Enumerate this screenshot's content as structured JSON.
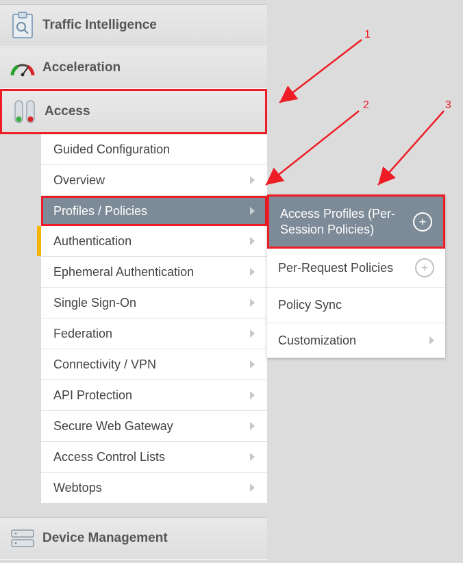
{
  "nav": {
    "traffic_intel": "Traffic Intelligence",
    "acceleration": "Acceleration",
    "access": "Access",
    "device_mgmt": "Device Management"
  },
  "access_sub": {
    "guided": "Guided Configuration",
    "overview": "Overview",
    "profiles": "Profiles / Policies",
    "auth": "Authentication",
    "ephemeral": "Ephemeral Authentication",
    "sso": "Single Sign-On",
    "federation": "Federation",
    "conn_vpn": "Connectivity / VPN",
    "api_protection": "API Protection",
    "swg": "Secure Web Gateway",
    "acl": "Access Control Lists",
    "webtops": "Webtops"
  },
  "fly": {
    "access_profiles": "Access Profiles (Per-Session Policies)",
    "per_request": "Per-Request Policies",
    "policy_sync": "Policy Sync",
    "customization": "Customization"
  },
  "annot": {
    "one": "1",
    "two": "2",
    "three": "3"
  }
}
